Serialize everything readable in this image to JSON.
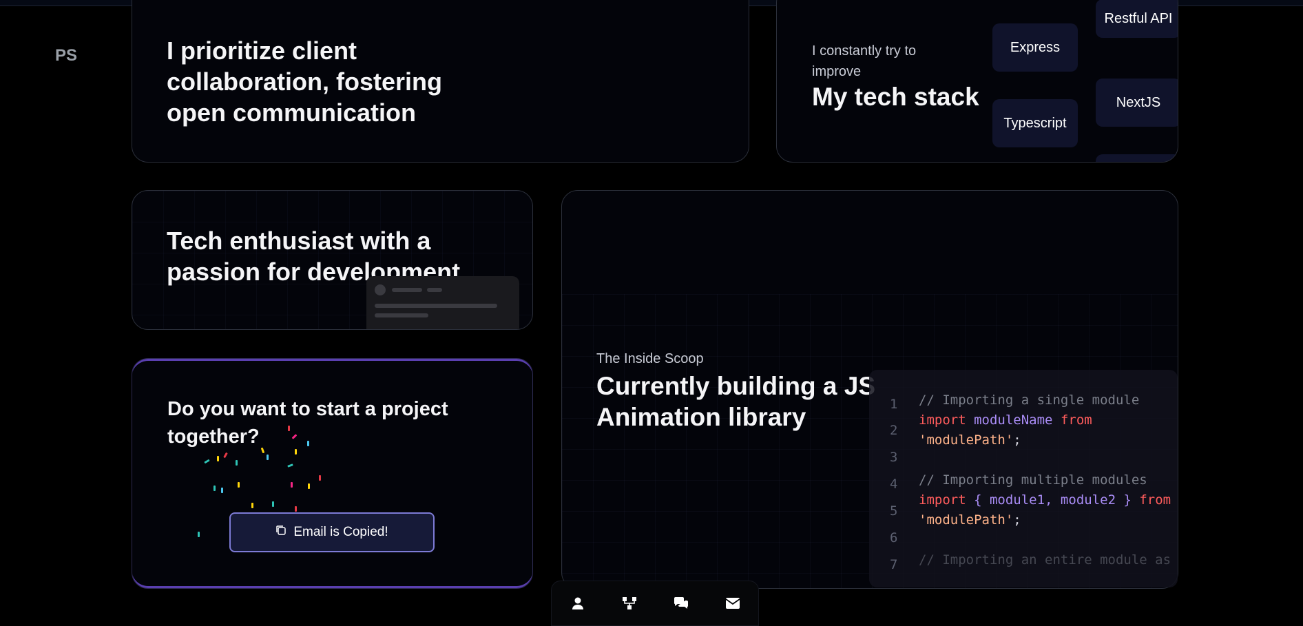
{
  "logo": "PS",
  "collab": {
    "headline_lines": [
      "I prioritize client",
      "collaboration, fostering",
      "open communication"
    ]
  },
  "techstack": {
    "kicker_lines": [
      "I constantly try to",
      "improve"
    ],
    "title": "My tech stack",
    "pills": [
      "Express",
      "Typescript",
      "Restful API",
      "NextJS"
    ]
  },
  "enthusiast": {
    "headline_lines": [
      "Tech enthusiast with a",
      "passion for development."
    ]
  },
  "project": {
    "headline_lines": [
      "Do you want to start a project",
      "together?"
    ],
    "email_button": "Email is Copied!"
  },
  "scoop": {
    "kicker": "The Inside Scoop",
    "headline_lines": [
      "Currently building a JS",
      "Animation library"
    ]
  },
  "code": {
    "line_numbers": [
      "1",
      "2",
      "3",
      "4",
      "5",
      "6",
      "7"
    ],
    "l1": "// Importing a single module",
    "l2_import": "import",
    "l2_name": "moduleName",
    "l2_from": "from",
    "l3_str": "'modulePath'",
    "l3_semi": ";",
    "l5": "// Importing multiple modules",
    "l6_import": "import",
    "l6_open": "{ ",
    "l6_names": "module1, module2",
    "l6_close": " }",
    "l6_from": "from",
    "l7_str": "'modulePath'",
    "l7_semi": ";",
    "l9": "// Importing an entire module as"
  },
  "dock": {
    "icons": [
      "user-icon",
      "network-icon",
      "comments-icon",
      "envelope-icon"
    ]
  },
  "colors": {
    "background": "#000000",
    "pill_bg": "#10132b",
    "accent_border": "#7d7bd6",
    "keyword": "#ff5c5c",
    "identifier": "#a98cf5",
    "string": "#ffb38a"
  }
}
